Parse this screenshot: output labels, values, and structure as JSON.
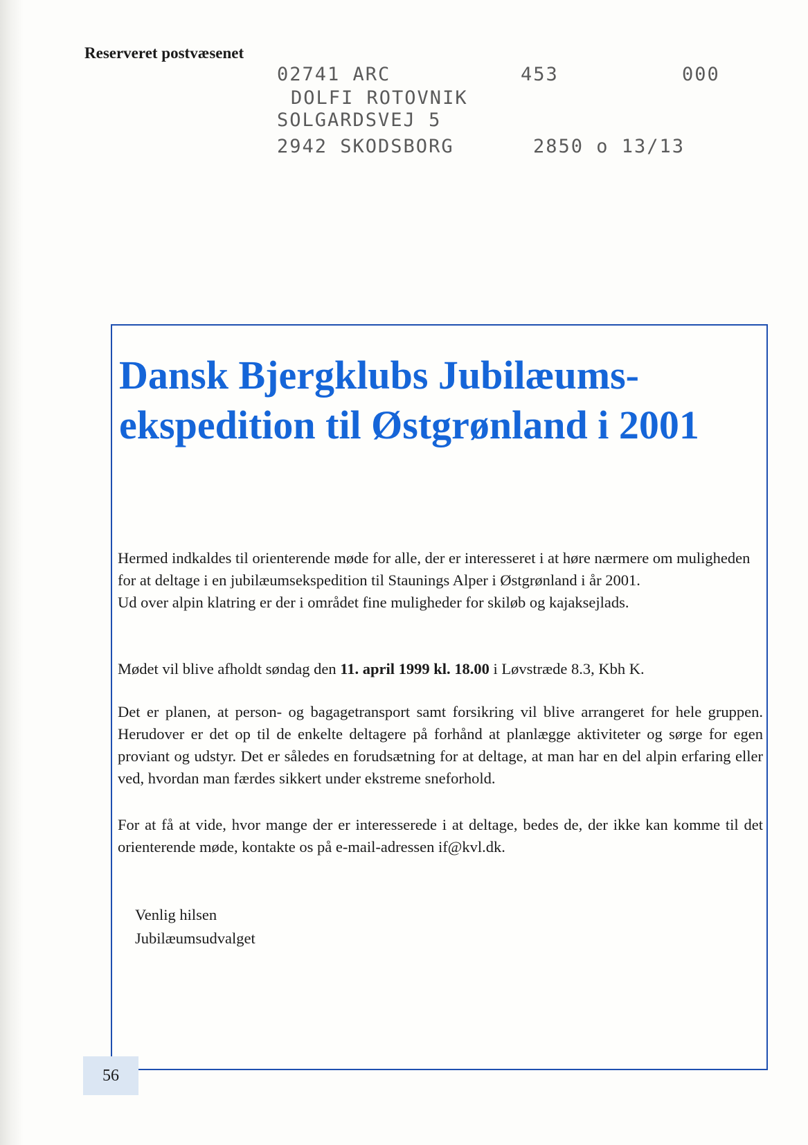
{
  "header": {
    "reserved_text": "Reserveret postvæsenet"
  },
  "address_label": {
    "line1_code": "02741 ARC",
    "line1_number": "453",
    "line1_suffix": "000",
    "name": "DOLFI ROTOVNIK",
    "street": "SOLGARDSVEJ 5",
    "city": "2942 SKODSBORG",
    "routing": "2850 o 13/13"
  },
  "notice": {
    "title": "Dansk Bjergklubs Jubilæums-ekspedition til Østgrønland i 2001",
    "paragraph1": "Hermed indkaldes til orienterende møde for alle, der er interesseret i at høre nærmere om muligheden for at deltage i en jubilæumsekspedition til Staunings Alper i Østgrønland i år 2001.",
    "paragraph1_extra": "Ud over alpin klatring er der i området fine muligheder for skiløb og kajaksejlads.",
    "meeting_prefix": "Mødet vil blive afholdt søndag den ",
    "meeting_datetime": "11. april 1999 kl. 18.00",
    "meeting_suffix": " i Løvstræde 8.3, Kbh K.",
    "paragraph3": "Det er planen, at person- og bagagetransport samt forsikring vil blive arrangeret for hele gruppen. Herudover er det op til de enkelte deltagere på forhånd at planlægge aktiviteter og sørge for egen proviant og udstyr. Det er således en forudsætning for at deltage, at man har en del alpin erfaring eller ved, hvordan man færdes sikkert under ekstreme sneforhold.",
    "paragraph4": "For at få at vide, hvor mange der er interesserede i at deltage, bedes de, der ikke kan komme til det orienterende møde, kontakte os på e-mail-adressen if@kvl.dk.",
    "greeting": "Venlig hilsen",
    "signature": "Jubilæumsudvalget"
  },
  "footer": {
    "page_number": "56"
  },
  "colors": {
    "title_blue": "#1565d8",
    "box_border": "#1e4fb0",
    "page_number_bg": "#dbe6f3"
  }
}
